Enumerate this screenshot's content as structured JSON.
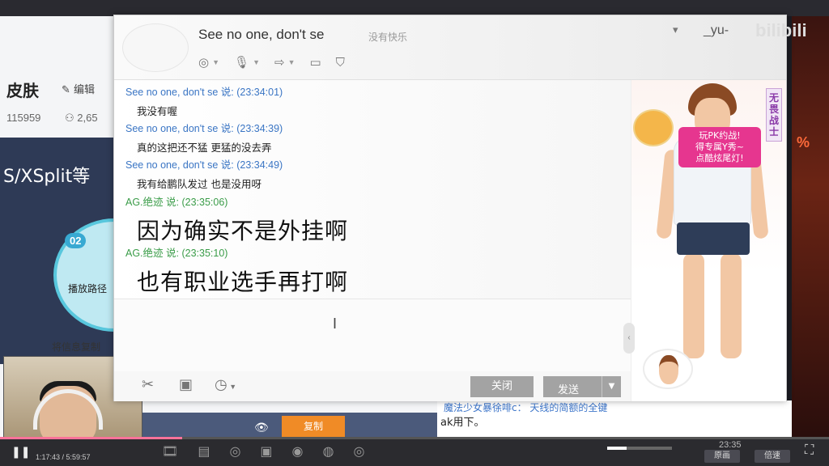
{
  "background_page": {
    "title": "皮肤",
    "edit_label": "编辑",
    "stat_a": "115959",
    "stat_b": "2,65",
    "banner_text": "S/XSplit等",
    "step_number": "02",
    "step_text": "播放路径",
    "copy_hint": "将信息复制",
    "copy_button": "复制",
    "right_msg_1": "魔法少女暴徐啡c：  天线的简额的全键",
    "right_msg_2": "ak用下。",
    "game_percent": "%"
  },
  "chat_window": {
    "contact_name": "See no one, don't se",
    "contact_status": "没有快乐",
    "user_tag": "_yu-",
    "watermark": "bilibili",
    "messages": [
      {
        "sender": "See no one, don't se 说:",
        "time": "(23:34:01)",
        "text": "我没有喔",
        "style": "blue",
        "big": false
      },
      {
        "sender": "See no one, don't se 说:",
        "time": "(23:34:39)",
        "text": "真的这把还不猛   更猛的没去弄",
        "style": "blue",
        "big": false
      },
      {
        "sender": "See no one, don't se 说:",
        "time": "(23:34:49)",
        "text": "我有给鹏队发过   也是没用呀",
        "style": "blue",
        "big": false
      },
      {
        "sender": "AG.绝迹 说:",
        "time": "(23:35:06)",
        "text": "因为确实不是外挂啊",
        "style": "green",
        "big": true
      },
      {
        "sender": "AG.绝迹 说:",
        "time": "(23:35:10)",
        "text": "也有职业选手再打啊",
        "style": "green",
        "big": true
      }
    ],
    "buttons": {
      "close": "关闭",
      "send": "发送"
    },
    "side_panel": {
      "promo_line_1": "玩PK约战!",
      "promo_line_2": "得专属Y秀~",
      "promo_line_3": "点酷炫尾灯!",
      "title_tag": "无畏战士"
    }
  },
  "player": {
    "time": "1:17:43 / 5:59:57",
    "progress": 0.22,
    "volume": 0.3,
    "btn_a": "原画",
    "btn_b": "倍速",
    "clock": "23:35"
  }
}
